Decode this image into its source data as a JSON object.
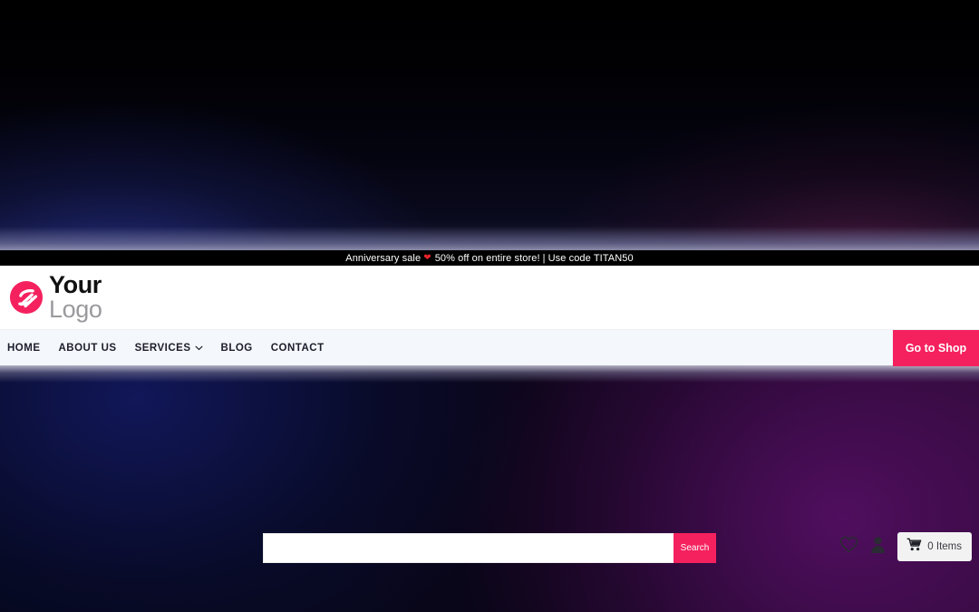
{
  "announcement": {
    "text_before": "Anniversary sale",
    "heart_icon": "heart-emoji",
    "text_middle": "50% off on entire store!",
    "separator": "|",
    "text_after": "Use code TITAN50"
  },
  "brand": {
    "mark_icon": "brand-swirl-icon",
    "name_bold": "Your",
    "name_light": "Logo",
    "accent_color": "#f5215e"
  },
  "search": {
    "value": "",
    "placeholder": "",
    "button_label": "Search"
  },
  "header_actions": {
    "wishlist_icon": "heart-outline-icon",
    "account_icon": "user-icon",
    "cart": {
      "icon": "shopping-cart-icon",
      "label": "0 Items",
      "count": 0
    }
  },
  "nav": {
    "items": [
      {
        "label": "HOME",
        "has_dropdown": false
      },
      {
        "label": "ABOUT US",
        "has_dropdown": false
      },
      {
        "label": "SERVICES",
        "has_dropdown": true,
        "dropdown_icon": "chevron-down-icon"
      },
      {
        "label": "BLOG",
        "has_dropdown": false
      },
      {
        "label": "CONTACT",
        "has_dropdown": false
      }
    ],
    "cta_label": "Go to Shop",
    "background_color": "#f4f7fb"
  },
  "theme": {
    "announce_bg": "#000000",
    "header_bg": "#ffffff",
    "pink": "#f5215e",
    "page_dark_navy": "#0a0a1e",
    "page_dark_purple": "#3b0f46"
  }
}
